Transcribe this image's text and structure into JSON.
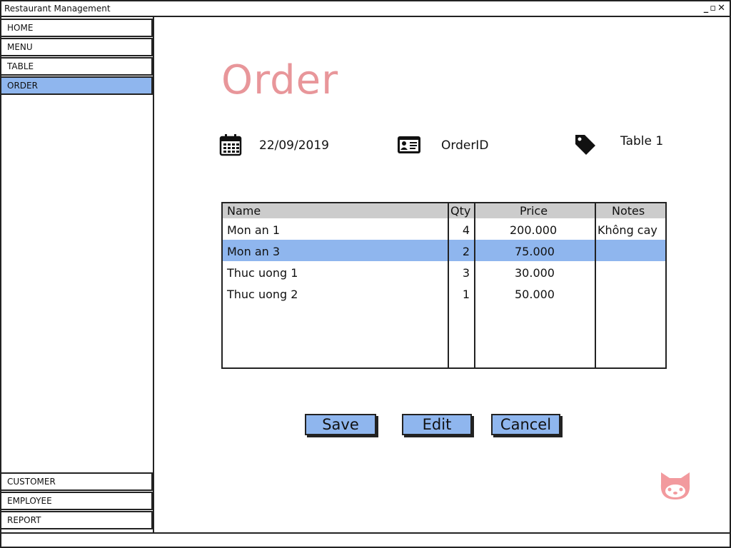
{
  "window": {
    "title": "Restaurant Management",
    "controls": {
      "minimize": "_",
      "maximize": "▫",
      "close": "✕"
    }
  },
  "sidebar": {
    "items_top": [
      {
        "label": "HOME"
      },
      {
        "label": "MENU"
      },
      {
        "label": "TABLE"
      },
      {
        "label": "ORDER",
        "active": true
      }
    ],
    "items_bottom": [
      {
        "label": "CUSTOMER"
      },
      {
        "label": "EMPLOYEE"
      },
      {
        "label": "REPORT"
      }
    ]
  },
  "main": {
    "title": "Order",
    "date": "22/09/2019",
    "order_id": "OrderID",
    "table": "Table 1"
  },
  "grid": {
    "columns": [
      "Name",
      "Qty",
      "Price",
      "Notes"
    ],
    "rows": [
      {
        "name": "Mon an 1",
        "qty": "4",
        "price": "200.000",
        "notes": "Không cay",
        "selected": false
      },
      {
        "name": "Mon an 3",
        "qty": "2",
        "price": "75.000",
        "notes": "",
        "selected": true
      },
      {
        "name": "Thuc uong 1",
        "qty": "3",
        "price": "30.000",
        "notes": "",
        "selected": false
      },
      {
        "name": "Thuc uong 2",
        "qty": "1",
        "price": "50.000",
        "notes": "",
        "selected": false
      }
    ]
  },
  "buttons": {
    "save": "Save",
    "edit": "Edit",
    "cancel": "Cancel"
  },
  "colors": {
    "accent": "#8fb6ee",
    "title": "#e8969a",
    "header": "#cccccc",
    "logo": "#f29a9e"
  },
  "icons": {
    "date": "calendar-icon",
    "order": "id-card-icon",
    "table": "tag-icon",
    "logo": "cat-logo-icon"
  }
}
